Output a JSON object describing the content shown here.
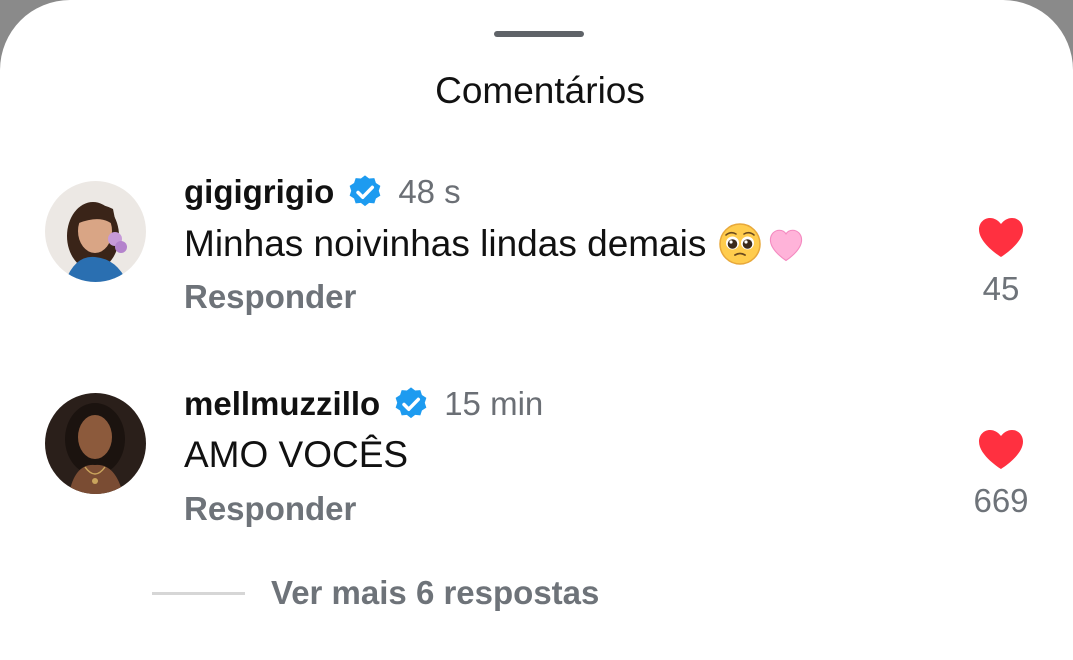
{
  "sheet": {
    "title": "Comentários"
  },
  "comments": [
    {
      "username": "gigigrigio",
      "verified": true,
      "time": "48 s",
      "text": "Minhas noivinhas lindas demais",
      "emojis": [
        "pleading-face-icon",
        "pink-heart-icon"
      ],
      "reply_label": "Responder",
      "likes": "45"
    },
    {
      "username": "mellmuzzillo",
      "verified": true,
      "time": "15 min",
      "text": "AMO VOCÊS",
      "emojis": [],
      "reply_label": "Responder",
      "likes": "669"
    }
  ],
  "replies": {
    "label": "Ver mais 6 respostas"
  },
  "colors": {
    "verified": "#1d9bf0",
    "like": "#ff3040",
    "secondary_text": "#6e7379"
  }
}
